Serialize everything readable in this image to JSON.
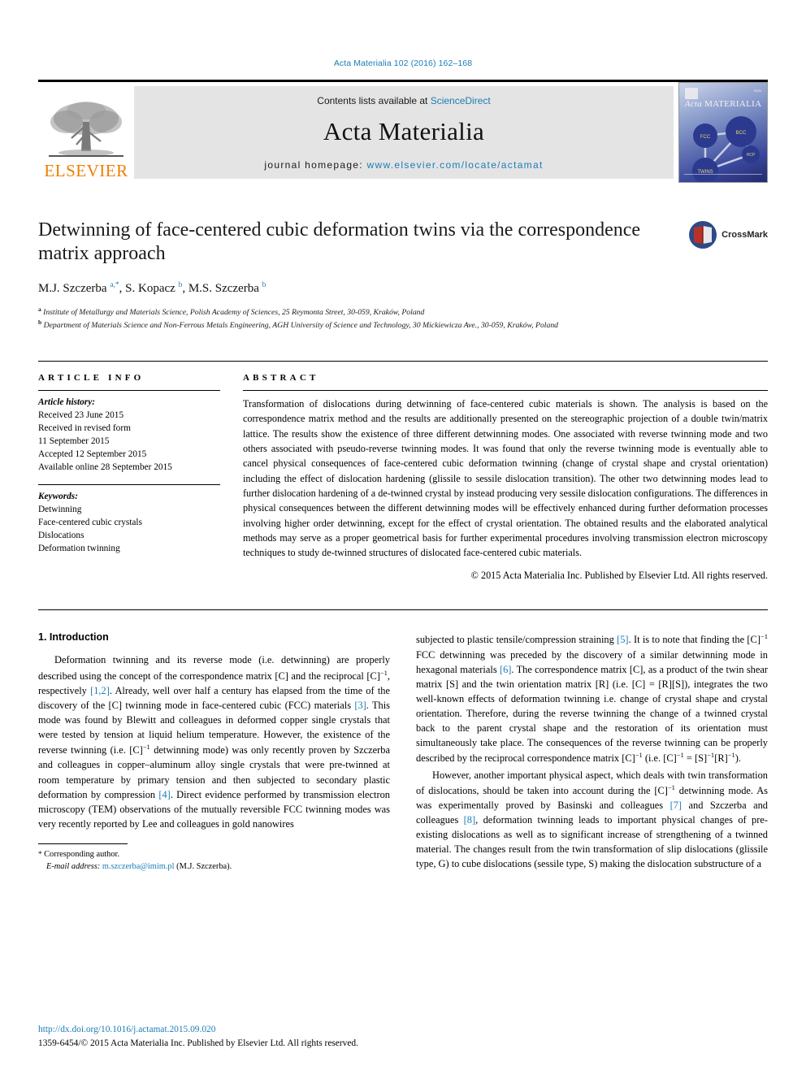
{
  "running_head": "Acta Materialia 102 (2016) 162–168",
  "masthead": {
    "contents_prefix": "Contents lists available at ",
    "contents_link": "ScienceDirect",
    "journal_name": "Acta Materialia",
    "homepage_prefix": "journal homepage: ",
    "homepage_link": "www.elsevier.com/locate/actamat",
    "publisher": "ELSEVIER",
    "publisher_logo": "elsevier-tree-logo",
    "cover": {
      "title_italic": "Acta",
      "title_caps": "MATERIALIA",
      "nodes": [
        "FCC",
        "BCC",
        "HCP",
        "TWINS"
      ]
    }
  },
  "article": {
    "title": "Detwinning of face-centered cubic deformation twins via the correspondence matrix approach",
    "authors_html": "M.J. Szczerba <sup class=\"star\">a,*</sup>, S. Kopacz <sup>b</sup>, M.S. Szczerba <sup>b</sup>",
    "authors_plain": "M.J. Szczerba a,*, S. Kopacz b, M.S. Szczerba b",
    "affiliation_a": "Institute of Metallurgy and Materials Science, Polish Academy of Sciences, 25 Reymonta Street, 30-059, Kraków, Poland",
    "affiliation_b": "Department of Materials Science and Non-Ferrous Metals Engineering, AGH University of Science and Technology, 30 Mickiewicza Ave., 30-059, Kraków, Poland",
    "crossmark_label": "CrossMark"
  },
  "info": {
    "heading": "ARTICLE INFO",
    "history_label": "Article history:",
    "history": [
      "Received 23 June 2015",
      "Received in revised form",
      "11 September 2015",
      "Accepted 12 September 2015",
      "Available online 28 September 2015"
    ],
    "keywords_label": "Keywords:",
    "keywords": [
      "Detwinning",
      "Face-centered cubic crystals",
      "Dislocations",
      "Deformation twinning"
    ]
  },
  "abstract": {
    "heading": "ABSTRACT",
    "text": "Transformation of dislocations during detwinning of face-centered cubic materials is shown. The analysis is based on the correspondence matrix method and the results are additionally presented on the stereographic projection of a double twin/matrix lattice. The results show the existence of three different detwinning modes. One associated with reverse twinning mode and two others associated with pseudo-reverse twinning modes. It was found that only the reverse twinning mode is eventually able to cancel physical consequences of face-centered cubic deformation twinning (change of crystal shape and crystal orientation) including the effect of dislocation hardening (glissile to sessile dislocation transition). The other two detwinning modes lead to further dislocation hardening of a de-twinned crystal by instead producing very sessile dislocation configurations. The differences in physical consequences between the different detwinning modes will be effectively enhanced during further deformation processes involving higher order detwinning, except for the effect of crystal orientation. The obtained results and the elaborated analytical methods may serve as a proper geometrical basis for further experimental procedures involving transmission electron microscopy techniques to study de-twinned structures of dislocated face-centered cubic materials.",
    "copyright": "© 2015 Acta Materialia Inc. Published by Elsevier Ltd. All rights reserved."
  },
  "body": {
    "section_heading": "1. Introduction",
    "left_p1_html": "Deformation twinning and its reverse mode (i.e. detwinning) are properly described using the concept of the correspondence matrix [C] and the reciprocal [C]<sup class=\"inl\">&#8722;1</sup>, respectively <span class=\"ref\">[1,2]</span>. Already, well over half a century has elapsed from the time of the discovery of the [C] twinning mode in face-centered cubic (FCC) materials <span class=\"ref\">[3]</span>. This mode was found by Blewitt and colleagues in deformed copper single crystals that were tested by tension at liquid helium temperature. However, the existence of the reverse twinning (i.e. [C]<sup class=\"inl\">&#8722;1</sup> detwinning mode) was only recently proven by Szczerba and colleagues in copper&#8211;aluminum alloy single crystals that were pre-twinned at room temperature by primary tension and then subjected to secondary plastic deformation by compression <span class=\"ref\">[4]</span>. Direct evidence performed by transmission electron microscopy (TEM) observations of the mutually reversible FCC twinning modes was very recently reported by Lee and colleagues in gold nanowires",
    "right_p1_html": "subjected to plastic tensile/compression straining <span class=\"ref\">[5]</span>. It is to note that finding the [C]<sup class=\"inl\">&#8722;1</sup> FCC detwinning was preceded by the discovery of a similar detwinning mode in hexagonal materials <span class=\"ref\">[6]</span>. The correspondence matrix [C], as a product of the twin shear matrix [S] and the twin orientation matrix [R] (i.e. [C] = [R][S]), integrates the two well-known effects of deformation twinning i.e. change of crystal shape and crystal orientation. Therefore, during the reverse twinning the change of a twinned crystal back to the parent crystal shape and the restoration of its orientation must simultaneously take place. The consequences of the reverse twinning can be properly described by the reciprocal correspondence matrix [C]<sup class=\"inl\">&#8722;1</sup> (i.e. [C]<sup class=\"inl\">&#8722;1</sup> = [S]<sup class=\"inl\">&#8722;1</sup>[R]<sup class=\"inl\">&#8722;1</sup>).",
    "right_p2_html": "However, another important physical aspect, which deals with twin transformation of dislocations, should be taken into account during the [C]<sup class=\"inl\">&#8722;1</sup> detwinning mode. As was experimentally proved by Basinski and colleagues <span class=\"ref\">[7]</span> and Szczerba and colleagues <span class=\"ref\">[8]</span>, deformation twinning leads to important physical changes of pre-existing dislocations as well as to significant increase of strengthening of a twinned material. The changes result from the twin transformation of slip dislocations (glissile type, G) to cube dislocations (sessile type, S) making the dislocation substructure of a"
  },
  "footnote": {
    "star": "*",
    "corresponding": "Corresponding author.",
    "email_label": "E-mail address:",
    "email": "m.szczerba@imim.pl",
    "email_owner": "(M.J. Szczerba)."
  },
  "page_footer": {
    "doi": "http://dx.doi.org/10.1016/j.actamat.2015.09.020",
    "issn_line": "1359-6454/© 2015 Acta Materialia Inc. Published by Elsevier Ltd. All rights reserved."
  },
  "colors": {
    "link": "#1a7db6",
    "elsevier_orange": "#f07d00",
    "band_gray": "#e4e4e4"
  }
}
